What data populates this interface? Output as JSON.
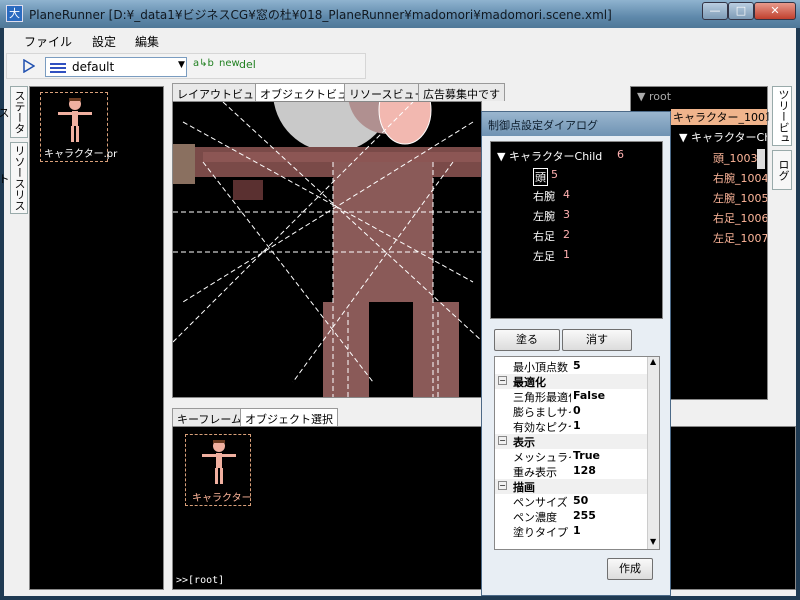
{
  "window": {
    "title": "PlaneRunner [D:¥_data1¥ビジネスCG¥窓の杜¥018_PlaneRunner¥madomori¥madomori.scene.xml]",
    "app_icon": "app-icon",
    "controls": {
      "minimize": "—",
      "maximize": "□",
      "close": "✕"
    }
  },
  "menu": [
    "ファイル",
    "設定",
    "編集"
  ],
  "toolbar": {
    "combo_value": "default",
    "buttons": {
      "ab": "a↳b",
      "new": "new",
      "del": "del"
    }
  },
  "side_tabs": [
    "ステータス",
    "リソースリスト"
  ],
  "resource_panel": {
    "item_label": "キャラクター.pr"
  },
  "view_tabs": [
    "レイアウトビュー",
    "オブジェクトビュー",
    "リソースビュー",
    "広告募集中です"
  ],
  "bottom_tabs": [
    "キーフレーム",
    "オブジェクト選択"
  ],
  "bottom": {
    "item_label": "キャラクター",
    "status": ">>[root]"
  },
  "dialog": {
    "title": "制御点設定ダイアログ",
    "tree": {
      "root": "キャラクターChild",
      "root_num": "6",
      "children": [
        {
          "label": "頭",
          "num": "5"
        },
        {
          "label": "右腕",
          "num": "4"
        },
        {
          "label": "左腕",
          "num": "3"
        },
        {
          "label": "右足",
          "num": "2"
        },
        {
          "label": "左足",
          "num": "1"
        }
      ]
    },
    "paint_button": "塗る",
    "erase_button": "消す",
    "props": {
      "first_row": {
        "name": "最小頂点数",
        "value": "5"
      },
      "cat_optimize": "最適化",
      "optimize_rows": [
        {
          "name": "三角形最適化",
          "value": "False"
        },
        {
          "name": "膨らましサイズ",
          "value": "0"
        },
        {
          "name": "有効なピクセル",
          "value": "1"
        }
      ],
      "cat_display": "表示",
      "display_rows": [
        {
          "name": "メッシュライン",
          "value": "True"
        },
        {
          "name": "重み表示",
          "value": "128"
        }
      ],
      "cat_draw": "描画",
      "draw_rows": [
        {
          "name": "ペンサイズ",
          "value": "50"
        },
        {
          "name": "ペン濃度",
          "value": "255"
        },
        {
          "name": "塗りタイプ",
          "value": "1"
        }
      ]
    },
    "create_button": "作成"
  },
  "right_tree": {
    "root": "root",
    "selected": "キャラクター_1001",
    "child": "キャラクターChild",
    "items": [
      "頭_1003",
      "右腕_1004",
      "左腕_1005",
      "右足_1006",
      "左足_1007"
    ]
  },
  "right_tabs": [
    "ツリービュー",
    "ログ"
  ]
}
